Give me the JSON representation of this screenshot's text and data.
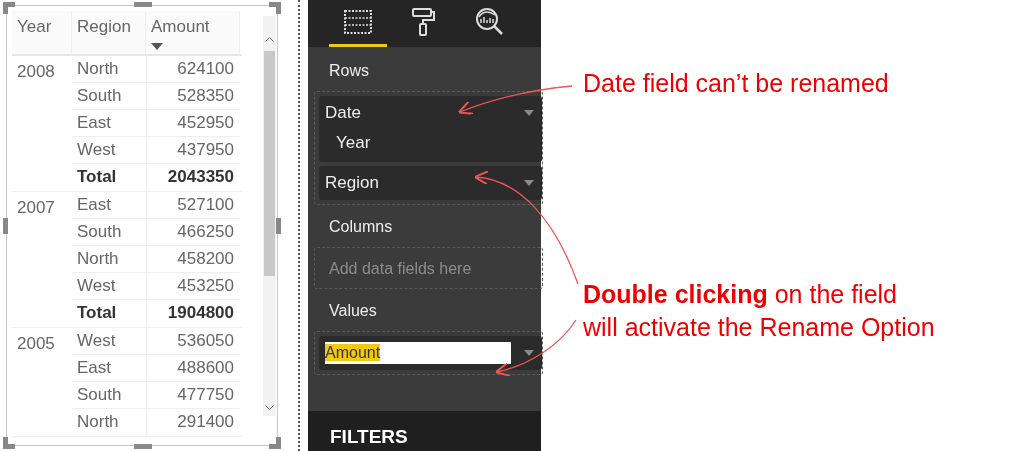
{
  "table": {
    "columns": [
      {
        "label": "Year",
        "sorted": false
      },
      {
        "label": "Region",
        "sorted": false
      },
      {
        "label": "Amount",
        "sorted": true
      }
    ],
    "groups": [
      {
        "year": "2008",
        "rows": [
          {
            "kind": "row",
            "region": "North",
            "amount": "624100"
          },
          {
            "kind": "row",
            "region": "South",
            "amount": "528350"
          },
          {
            "kind": "row",
            "region": "East",
            "amount": "452950"
          },
          {
            "kind": "row",
            "region": "West",
            "amount": "437950"
          },
          {
            "kind": "total",
            "region": "Total",
            "amount": "2043350"
          }
        ]
      },
      {
        "year": "2007",
        "rows": [
          {
            "kind": "row",
            "region": "East",
            "amount": "527100"
          },
          {
            "kind": "row",
            "region": "South",
            "amount": "466250"
          },
          {
            "kind": "row",
            "region": "North",
            "amount": "458200"
          },
          {
            "kind": "row",
            "region": "West",
            "amount": "453250"
          },
          {
            "kind": "total",
            "region": "Total",
            "amount": "1904800"
          }
        ]
      },
      {
        "year": "2005",
        "rows": [
          {
            "kind": "row",
            "region": "West",
            "amount": "536050"
          },
          {
            "kind": "row",
            "region": "East",
            "amount": "488600"
          },
          {
            "kind": "row",
            "region": "South",
            "amount": "477750"
          },
          {
            "kind": "row",
            "region": "North",
            "amount": "291400"
          }
        ]
      }
    ]
  },
  "pane": {
    "tabs": [
      {
        "kind": "fields",
        "selected": true
      },
      {
        "kind": "format",
        "selected": false
      },
      {
        "kind": "analytics",
        "selected": false
      }
    ],
    "sections": [
      {
        "title": "Rows",
        "fields": [
          {
            "name": "Date",
            "children": [
              {
                "name": "Year"
              }
            ]
          },
          {
            "name": "Region"
          }
        ]
      },
      {
        "title": "Columns",
        "placeholder": "Add data fields here"
      },
      {
        "title": "Values",
        "fields": [
          {
            "name": "Amount",
            "editing": true,
            "text_selected": true
          }
        ]
      }
    ],
    "filters_title": "FILTERS"
  },
  "annotations": [
    {
      "lines": [
        "Date field can’t be renamed"
      ]
    },
    {
      "lines": [
        "**Double clicking** on the field",
        "will activate the Rename Option"
      ]
    }
  ]
}
